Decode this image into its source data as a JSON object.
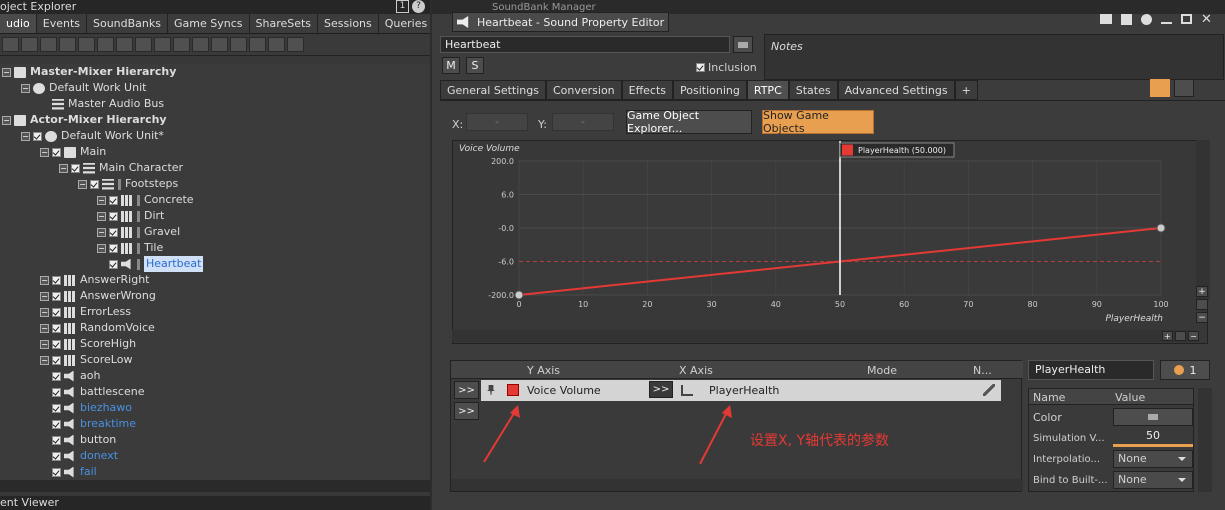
{
  "left": {
    "title": "oject Explorer",
    "tabs": [
      "udio",
      "Events",
      "SoundBanks",
      "Game Syncs",
      "ShareSets",
      "Sessions",
      "Queries"
    ],
    "tree": [
      {
        "label": "Master-Mixer Hierarchy",
        "bold": true
      },
      {
        "label": "Default Work Unit"
      },
      {
        "label": "Master Audio Bus"
      },
      {
        "label": "Actor-Mixer Hierarchy",
        "bold": true
      },
      {
        "label": "Default Work Unit*"
      },
      {
        "label": "Main"
      },
      {
        "label": "Main Character"
      },
      {
        "label": "Footsteps"
      },
      {
        "label": "Concrete"
      },
      {
        "label": "Dirt"
      },
      {
        "label": "Gravel"
      },
      {
        "label": "Tile"
      },
      {
        "label": "Heartbeat"
      },
      {
        "label": "AnswerRight"
      },
      {
        "label": "AnswerWrong"
      },
      {
        "label": "ErrorLess"
      },
      {
        "label": "RandomVoice"
      },
      {
        "label": "ScoreHigh"
      },
      {
        "label": "ScoreLow"
      },
      {
        "label": "aoh"
      },
      {
        "label": "battlescene"
      },
      {
        "label": "biezhawo"
      },
      {
        "label": "breaktime"
      },
      {
        "label": "button"
      },
      {
        "label": "donext"
      },
      {
        "label": "fail"
      }
    ],
    "bottom_title": "ent Viewer",
    "counter": "1"
  },
  "right": {
    "top_title": "SoundBank Manager",
    "editor_title": "Heartbeat - Sound Property Editor",
    "name_value": "Heartbeat",
    "m_label": "M",
    "s_label": "S",
    "inclusion_label": "Inclusion",
    "notes_label": "Notes",
    "tabs": [
      "General Settings",
      "Conversion",
      "Effects",
      "Positioning",
      "RTPC",
      "States",
      "Advanced Settings",
      "+"
    ],
    "x_label": "X:",
    "y_label": "Y:",
    "x_value": "-",
    "y_value": "-",
    "goe_button": "Game Object Explorer...",
    "show_go_button": "Show Game Objects",
    "graph_y_title": "Voice Volume",
    "graph_x_title": "PlayerHealth",
    "cursor_label": "PlayerHealth (50.000)",
    "y_ticks": [
      "200.0",
      "6.0",
      "-0.0",
      "-6.0",
      "-200.0"
    ],
    "x_ticks": [
      "0",
      "10",
      "20",
      "30",
      "40",
      "50",
      "60",
      "70",
      "80",
      "90",
      "100"
    ],
    "table": {
      "headers": [
        "Y Axis",
        "X Axis",
        "Mode",
        "N..."
      ],
      "row_y": "Voice Volume",
      "row_x": "PlayerHealth",
      "expand": ">>"
    },
    "annotation": "设置X, Y轴代表的参数",
    "props": {
      "name": "PlayerHealth",
      "count": "1",
      "headers": [
        "Name",
        "Value"
      ],
      "rows": [
        {
          "name": "Color",
          "value": ""
        },
        {
          "name": "Simulation V...",
          "value": "50"
        },
        {
          "name": "Interpolatio...",
          "value": "None"
        },
        {
          "name": "Bind to Built-...",
          "value": "None"
        }
      ]
    },
    "colors": {
      "curve": "#e53935",
      "accent": "#e8a050",
      "rtpc_swatch": "#e53935"
    }
  },
  "chart_data": {
    "type": "line",
    "title": "",
    "ylabel": "Voice Volume",
    "xlabel": "PlayerHealth",
    "x": [
      0,
      100
    ],
    "y": [
      -200,
      0
    ],
    "xlim": [
      0,
      100
    ],
    "y_tick_labels": [
      "200.0",
      "6.0",
      "-0.0",
      "-6.0",
      "-200.0"
    ],
    "cursor_x": 50,
    "cursor_label": "PlayerHealth (50.000)",
    "reference_line": "-6.0"
  }
}
